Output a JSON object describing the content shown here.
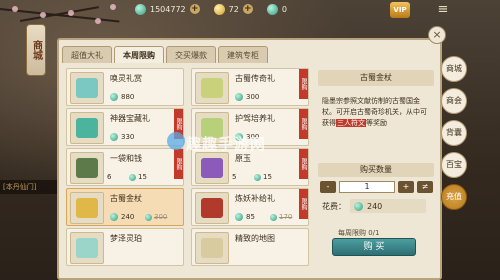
{
  "currency": {
    "jade_amount": "1504772",
    "gold_amount": "72",
    "token_amount": "0",
    "add_label": "+",
    "vip_label": "VIP",
    "menu_label": "≡"
  },
  "shop_badge": "商城",
  "left_strip": "[本丹仙门]",
  "tabs": [
    {
      "label": "超值大礼",
      "active": false
    },
    {
      "label": "本周限购",
      "active": true
    },
    {
      "label": "交买爆款",
      "active": false
    },
    {
      "label": "建筑专柜",
      "active": false
    }
  ],
  "close_label": "×",
  "items": [
    {
      "name": "唤灵礼赏",
      "price": "880",
      "old_price": "",
      "stock": "",
      "ribbon": "",
      "color": "#7bc7c2",
      "selected": false
    },
    {
      "name": "古蜀传奇礼",
      "price": "300",
      "old_price": "",
      "stock": "",
      "ribbon": "限购",
      "color": "#c9d27a",
      "selected": false
    },
    {
      "name": "神器宝藏礼",
      "price": "330",
      "old_price": "",
      "stock": "",
      "ribbon": "限购",
      "color": "#4cb39e",
      "selected": false
    },
    {
      "name": "护驾培养礼",
      "price": "300",
      "old_price": "",
      "stock": "",
      "ribbon": "限购",
      "color": "#b9d07a",
      "selected": false
    },
    {
      "name": "一袋和钱",
      "price": "15",
      "old_price": "",
      "stock": "6",
      "ribbon": "限购",
      "color": "#5c7a4a",
      "selected": false
    },
    {
      "name": "原玉",
      "price": "15",
      "old_price": "",
      "stock": "5",
      "ribbon": "限购",
      "color": "#8c5ab8",
      "selected": false
    },
    {
      "name": "古蜀金杖",
      "price": "240",
      "old_price": "300",
      "stock": "",
      "ribbon": "",
      "color": "#e0b84a",
      "selected": true
    },
    {
      "name": "炼妖补给礼",
      "price": "85",
      "old_price": "170",
      "stock": "",
      "ribbon": "限购",
      "color": "#b13a2c",
      "selected": false
    },
    {
      "name": "梦泽灵珀",
      "price": "",
      "old_price": "",
      "stock": "",
      "ribbon": "",
      "color": "#9bd4c9",
      "selected": false
    },
    {
      "name": "精致的地图",
      "price": "",
      "old_price": "",
      "stock": "",
      "ribbon": "",
      "color": "#d8cba0",
      "selected": false
    }
  ],
  "detail": {
    "title": "古蜀金杖",
    "desc_1": "隐墨宗参照文献仿制的古蜀国金杖。",
    "desc_2": "可开启古蜀奇珍机关，从中可获得",
    "desc_hl": "三人符文",
    "desc_3": "等奖励",
    "qty_title": "购买数量",
    "minus": "-",
    "qty": "1",
    "plus": "+",
    "max": "≠",
    "cost_label": "花费：",
    "cost_value": "240",
    "limit_label": "每周限购 0/1",
    "buy_label": "购 买"
  },
  "categories": [
    {
      "label": "商城",
      "active": false
    },
    {
      "label": "商会",
      "active": false
    },
    {
      "label": "背囊",
      "active": false
    },
    {
      "label": "百宝",
      "active": false
    },
    {
      "label": "充值",
      "active": true
    }
  ],
  "watermark": "趣趣手游网"
}
